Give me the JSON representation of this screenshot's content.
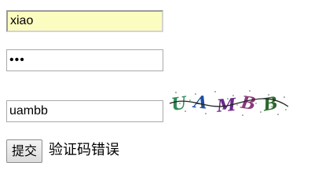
{
  "form": {
    "username_value": "xiao",
    "password_value": "•••",
    "captcha_value": "uambb",
    "submit_label": "提交",
    "error_message": "验证码错误"
  },
  "captcha_image": {
    "text": "UAMBB",
    "colors": [
      "#2e8b57",
      "#1e4fa0",
      "#6a2a8a",
      "#8b3a7a",
      "#2a6a2a"
    ]
  }
}
